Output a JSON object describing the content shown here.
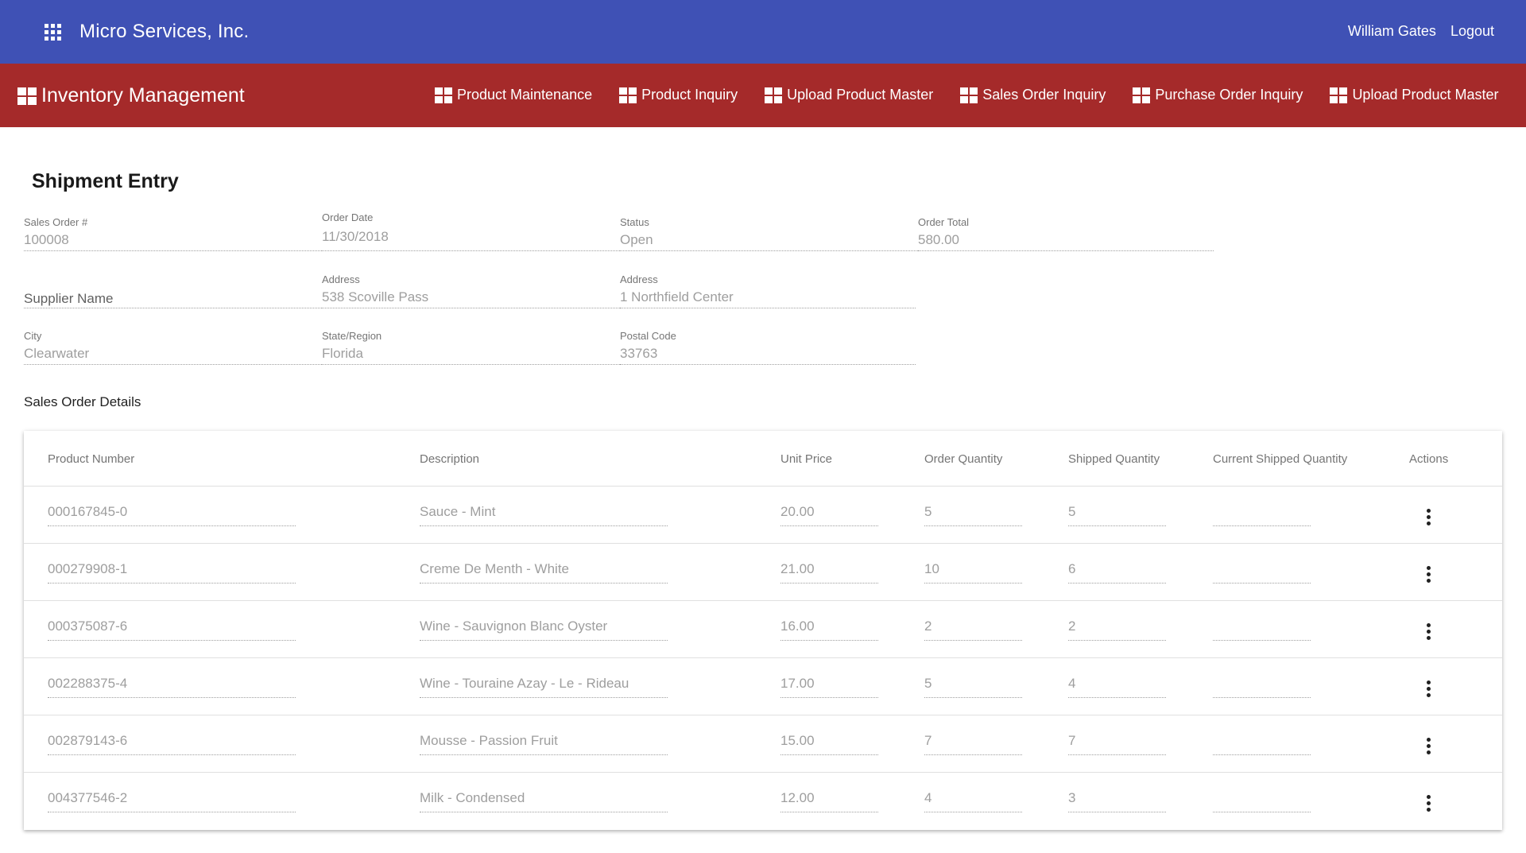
{
  "app": {
    "company": "Micro Services, Inc.",
    "user_name": "William Gates",
    "logout_label": "Logout"
  },
  "module": {
    "title": "Inventory Management",
    "nav": [
      {
        "label": "Product Maintenance"
      },
      {
        "label": "Product Inquiry"
      },
      {
        "label": "Upload Product Master"
      },
      {
        "label": "Sales Order Inquiry"
      },
      {
        "label": "Purchase Order Inquiry"
      },
      {
        "label": "Upload Product Master"
      }
    ]
  },
  "page": {
    "title": "Shipment Entry",
    "fields": {
      "sales_order": {
        "label": "Sales Order #",
        "value": "100008"
      },
      "order_date": {
        "label": "Order Date",
        "value": "11/30/2018"
      },
      "status": {
        "label": "Status",
        "value": "Open"
      },
      "order_total": {
        "label": "Order Total",
        "value": "580.00"
      },
      "supplier_name": {
        "placeholder": "Supplier Name"
      },
      "address1": {
        "label": "Address",
        "value": "538 Scoville Pass"
      },
      "address2": {
        "label": "Address",
        "value": "1 Northfield Center"
      },
      "city": {
        "label": "City",
        "value": "Clearwater"
      },
      "state": {
        "label": "State/Region",
        "value": "Florida"
      },
      "postal_code": {
        "label": "Postal Code",
        "value": "33763"
      }
    },
    "details_label": "Sales Order Details"
  },
  "table": {
    "headers": {
      "product_number": "Product Number",
      "description": "Description",
      "unit_price": "Unit Price",
      "order_quantity": "Order Quantity",
      "shipped_quantity": "Shipped Quantity",
      "current_shipped_quantity": "Current Shipped Quantity",
      "actions": "Actions"
    },
    "rows": [
      {
        "product_number": "000167845-0",
        "description": "Sauce - Mint",
        "unit_price": "20.00",
        "order_quantity": "5",
        "shipped_quantity": "5",
        "current_shipped_quantity": ""
      },
      {
        "product_number": "000279908-1",
        "description": "Creme De Menth - White",
        "unit_price": "21.00",
        "order_quantity": "10",
        "shipped_quantity": "6",
        "current_shipped_quantity": ""
      },
      {
        "product_number": "000375087-6",
        "description": "Wine - Sauvignon Blanc Oyster",
        "unit_price": "16.00",
        "order_quantity": "2",
        "shipped_quantity": "2",
        "current_shipped_quantity": ""
      },
      {
        "product_number": "002288375-4",
        "description": "Wine - Touraine Azay - Le - Rideau",
        "unit_price": "17.00",
        "order_quantity": "5",
        "shipped_quantity": "4",
        "current_shipped_quantity": ""
      },
      {
        "product_number": "002879143-6",
        "description": "Mousse - Passion Fruit",
        "unit_price": "15.00",
        "order_quantity": "7",
        "shipped_quantity": "7",
        "current_shipped_quantity": ""
      },
      {
        "product_number": "004377546-2",
        "description": "Milk - Condensed",
        "unit_price": "12.00",
        "order_quantity": "4",
        "shipped_quantity": "3",
        "current_shipped_quantity": ""
      }
    ]
  },
  "colors": {
    "app_bar": "#3f51b5",
    "module_bar": "#a52a2a"
  },
  "icons": {
    "apps": "apps-grid-icon",
    "module": "dashboard-tiles-icon",
    "row_action": "more-vert-icon"
  }
}
